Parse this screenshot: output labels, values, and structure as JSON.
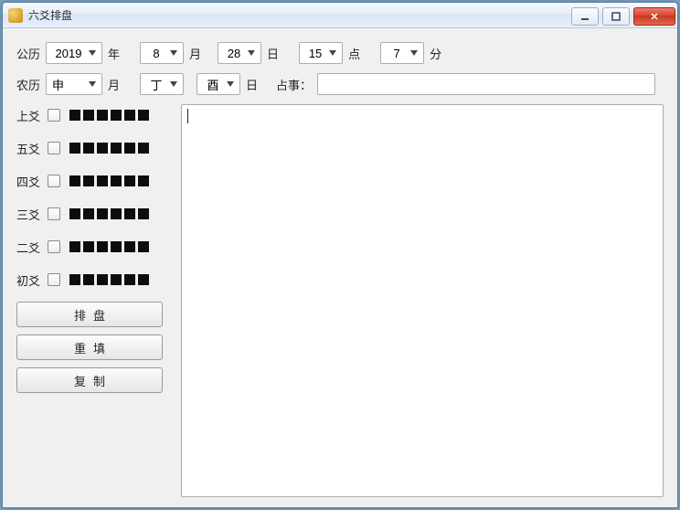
{
  "window": {
    "title": "六爻排盘"
  },
  "solar": {
    "label": "公历",
    "year": "2019",
    "year_unit": "年",
    "month": "8",
    "month_unit": "月",
    "day": "28",
    "day_unit": "日",
    "hour": "15",
    "hour_unit": "点",
    "minute": "7",
    "minute_unit": "分"
  },
  "lunar": {
    "label": "农历",
    "month_branch": "申",
    "month_unit": "月",
    "day_stem": "丁",
    "day_branch": "酉",
    "day_unit": "日",
    "matter_label": "占事：",
    "matter_value": ""
  },
  "yao": {
    "rows": [
      {
        "label": "上爻"
      },
      {
        "label": "五爻"
      },
      {
        "label": "四爻"
      },
      {
        "label": "三爻"
      },
      {
        "label": "二爻"
      },
      {
        "label": "初爻"
      }
    ]
  },
  "buttons": {
    "paipan": "排盘",
    "chongtian": "重填",
    "fuzhi": "复制"
  },
  "output": ""
}
